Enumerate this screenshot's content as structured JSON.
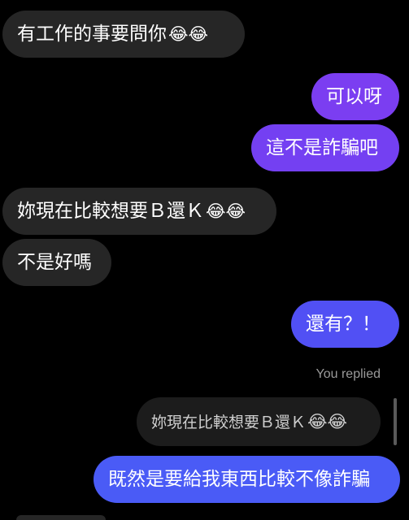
{
  "messages": [
    {
      "text": "有工作的事要問你",
      "emoji": "😂😂"
    },
    {
      "text": "可以呀"
    },
    {
      "text": "這不是詐騙吧"
    },
    {
      "text": "妳現在比較想要Ｂ還Ｋ",
      "emoji": "😂😂"
    },
    {
      "text": "不是好嗎"
    },
    {
      "text": "還有？！"
    },
    {
      "text": "既然是要給我東西比較不像詐騙"
    }
  ],
  "reply": {
    "label": "You replied",
    "quoted_text": "妳現在比較想要Ｂ還Ｋ",
    "quoted_emoji": "😂😂"
  },
  "colors": {
    "background": "#000000",
    "incoming_bubble": "#262626",
    "outgoing_gradient": [
      "#7a3ff0",
      "#4a5cf6"
    ],
    "meta_text": "#9a9a9a"
  }
}
